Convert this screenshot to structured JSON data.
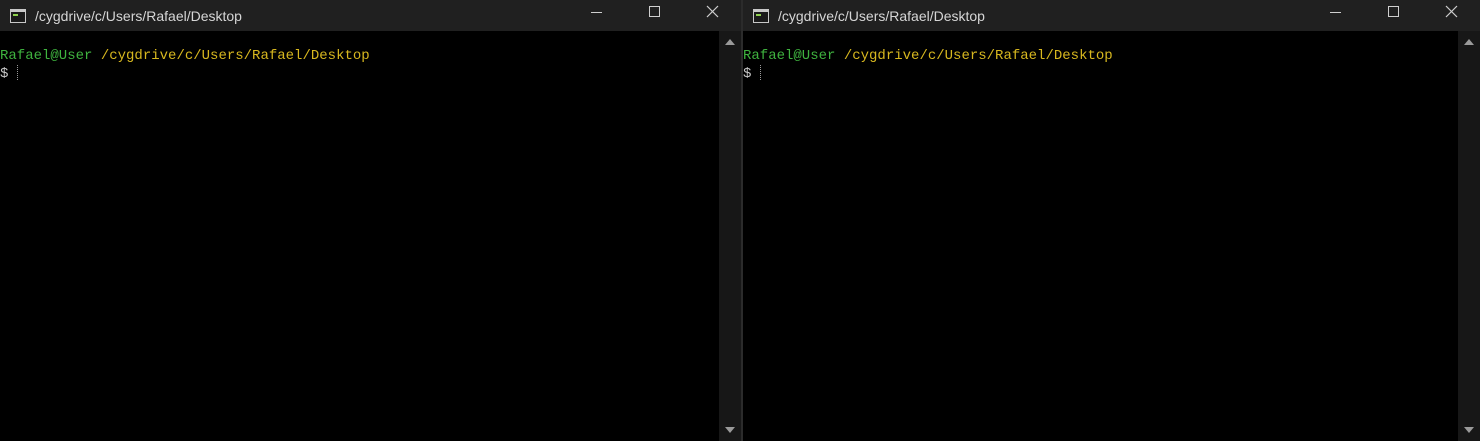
{
  "windows": [
    {
      "title": "/cygdrive/c/Users/Rafael/Desktop",
      "prompt": {
        "user": "Rafael@User",
        "path": "/cygdrive/c/Users/Rafael/Desktop",
        "symbol": "$"
      }
    },
    {
      "title": "/cygdrive/c/Users/Rafael/Desktop",
      "prompt": {
        "user": "Rafael@User",
        "path": "/cygdrive/c/Users/Rafael/Desktop",
        "symbol": "$"
      }
    }
  ],
  "icons": {
    "app": "terminal-icon",
    "minimize": "minimize-icon",
    "maximize": "maximize-icon",
    "close": "close-icon",
    "scroll_up": "scroll-up-arrow-icon",
    "scroll_down": "scroll-down-arrow-icon"
  },
  "colors": {
    "titlebar": "#202020",
    "terminal_bg": "#000000",
    "prompt_user": "#3fb33f",
    "prompt_path": "#d8b81f",
    "text": "#c8c8c8"
  }
}
